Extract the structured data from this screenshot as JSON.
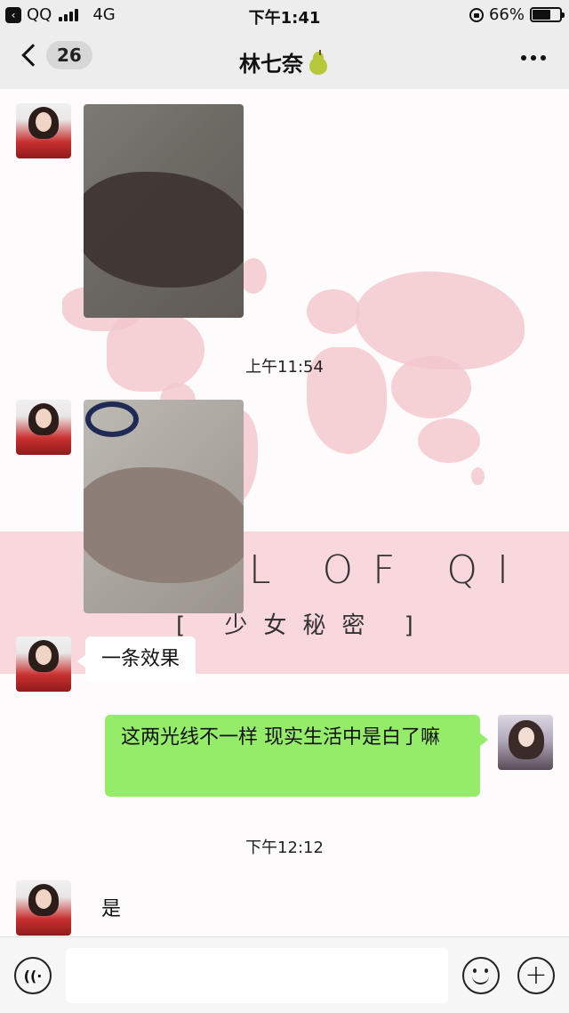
{
  "status_bar": {
    "carrier": "QQ",
    "network": "4G",
    "time": "下午1:41",
    "battery_percent": "66%",
    "battery_level": 0.66
  },
  "nav": {
    "back_badge": "26",
    "title": "林七奈"
  },
  "wallpaper": {
    "title": "L OF QI",
    "subtitle": "[ 少女秘密 ]"
  },
  "messages": {
    "time_1": "上午11:54",
    "text_1": "一条效果",
    "text_2": "这两光线不一样 现实生活中是白了嘛",
    "time_2": "下午12:12",
    "text_3": "是"
  },
  "input_bar": {
    "placeholder": ""
  },
  "colors": {
    "my_bubble": "#95ec69",
    "their_bubble": "#ffffff",
    "bar_bg": "#ededed"
  }
}
